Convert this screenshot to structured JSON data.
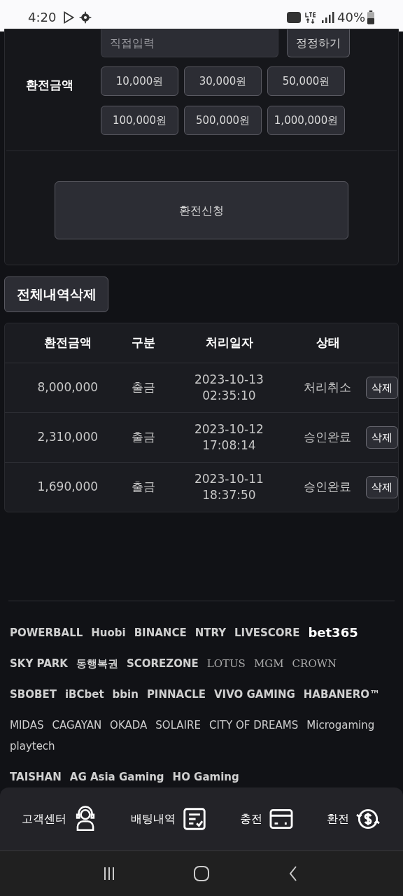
{
  "status_bar": {
    "time": "4:20",
    "battery": "40%"
  },
  "form": {
    "input_placeholder": "직접입력",
    "correct_button": "정정하기",
    "amount_label": "환전금액",
    "amount_buttons": [
      "10,000원",
      "30,000원",
      "50,000원",
      "100,000원",
      "500,000원",
      "1,000,000원"
    ],
    "submit_button": "환전신청"
  },
  "delete_all_button": "전체내역삭제",
  "table": {
    "columns": [
      "환전금액",
      "구분",
      "처리일자",
      "상태"
    ],
    "rows": [
      {
        "amount": "8,000,000",
        "type": "출금",
        "date": "2023-10-13 02:35:10",
        "status": "처리취소",
        "action": "삭제"
      },
      {
        "amount": "2,310,000",
        "type": "출금",
        "date": "2023-10-12 17:08:14",
        "status": "승인완료",
        "action": "삭제"
      },
      {
        "amount": "1,690,000",
        "type": "출금",
        "date": "2023-10-11 18:37:50",
        "status": "승인완료",
        "action": "삭제"
      }
    ]
  },
  "partner_logos": [
    [
      "POWERBALL",
      "Huobi",
      "BINANCE",
      "NTRY",
      "LIVESCORE",
      "bet365"
    ],
    [
      "SKY PARK",
      "동행복권",
      "SCOREZONE",
      "LOTUS",
      "MGM",
      "CROWN"
    ],
    [
      "SBOBET",
      "iBCbet",
      "bbin",
      "PINNACLE",
      "VIVO GAMING",
      "HABANERO™"
    ],
    [
      "MIDAS",
      "CAGAYAN",
      "OKADA",
      "SOLAIRE",
      "CITY OF DREAMS",
      "Microgaming",
      "playtech"
    ],
    [
      "TAISHAN",
      "AG Asia Gaming",
      "HO Gaming"
    ]
  ],
  "bottom_nav": [
    {
      "label": "고객센터",
      "kind": "support"
    },
    {
      "label": "배팅내역",
      "kind": "history"
    },
    {
      "label": "충전",
      "kind": "card"
    },
    {
      "label": "환전",
      "kind": "exchange"
    }
  ]
}
